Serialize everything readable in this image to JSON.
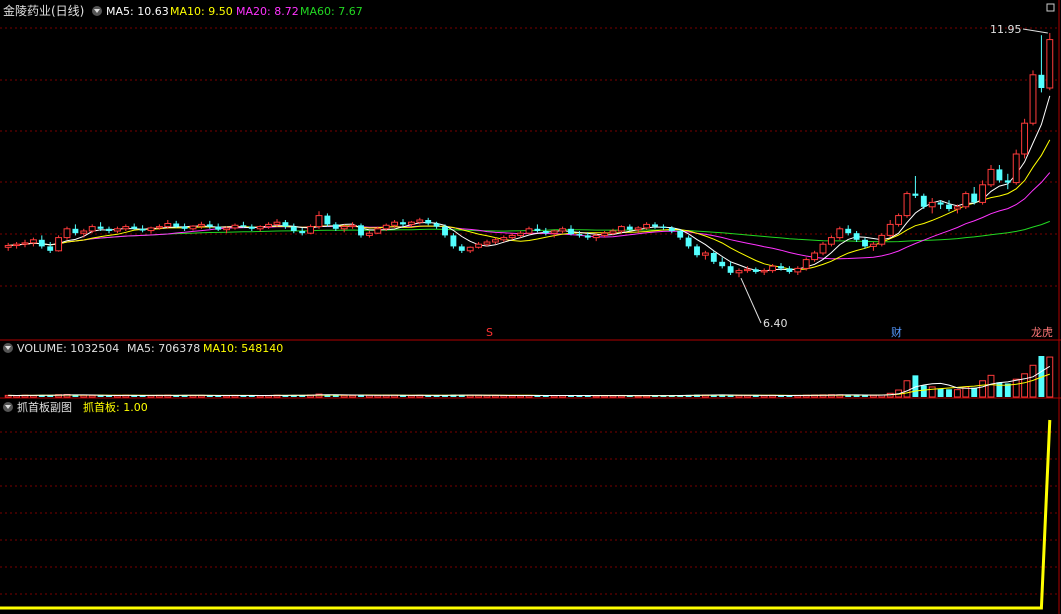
{
  "colors": {
    "background": "#000000",
    "grid": "#7a0000",
    "panel_border": "#b00000",
    "up": "#ff3b3b",
    "down": "#54ffff",
    "title_text": "#e0e0e0",
    "ma5": "#ffffff",
    "ma10": "#ffff00",
    "ma20": "#ff33ff",
    "ma60": "#22d822",
    "indicator": "#ffff00",
    "marker_s": "#ff3333",
    "marker_cai": "#5599ff",
    "marker_longhu": "#ff7777"
  },
  "header": {
    "stock_title": "金陵药业(日线)",
    "ma5": "MA5: 10.63",
    "ma10": "MA10: 9.50",
    "ma20": "MA20: 8.72",
    "ma60": "MA60: 7.67"
  },
  "annotations": {
    "high": "11.95",
    "low": "6.40",
    "marker_s": "S",
    "marker_cai": "财",
    "marker_longhu": "龙虎"
  },
  "volume_header": {
    "volume": "VOLUME: 1032504",
    "ma5": "MA5: 706378",
    "ma10": "MA10: 548140"
  },
  "indicator_header": {
    "name": "抓首板副图",
    "value": "抓首板: 1.00"
  },
  "chart_data": {
    "type": "candlestick",
    "title": "金陵药业(日线)",
    "price_range": [
      5.2,
      12.2
    ],
    "annotated_high": 11.95,
    "annotated_low": 6.4,
    "grid": true,
    "candles": [
      [
        7.08,
        7.18,
        7.0,
        7.12
      ],
      [
        7.12,
        7.2,
        7.05,
        7.15
      ],
      [
        7.15,
        7.25,
        7.08,
        7.18
      ],
      [
        7.18,
        7.3,
        7.1,
        7.25
      ],
      [
        7.25,
        7.35,
        7.05,
        7.1
      ],
      [
        7.1,
        7.2,
        6.95,
        7.0
      ],
      [
        7.0,
        7.35,
        6.98,
        7.3
      ],
      [
        7.3,
        7.55,
        7.25,
        7.5
      ],
      [
        7.5,
        7.6,
        7.35,
        7.4
      ],
      [
        7.4,
        7.5,
        7.3,
        7.45
      ],
      [
        7.45,
        7.6,
        7.4,
        7.55
      ],
      [
        7.55,
        7.65,
        7.45,
        7.5
      ],
      [
        7.5,
        7.55,
        7.4,
        7.45
      ],
      [
        7.45,
        7.55,
        7.4,
        7.5
      ],
      [
        7.5,
        7.6,
        7.45,
        7.55
      ],
      [
        7.55,
        7.62,
        7.48,
        7.5
      ],
      [
        7.5,
        7.58,
        7.42,
        7.46
      ],
      [
        7.46,
        7.55,
        7.4,
        7.52
      ],
      [
        7.52,
        7.6,
        7.48,
        7.55
      ],
      [
        7.55,
        7.7,
        7.5,
        7.62
      ],
      [
        7.62,
        7.68,
        7.52,
        7.55
      ],
      [
        7.55,
        7.62,
        7.45,
        7.5
      ],
      [
        7.5,
        7.58,
        7.46,
        7.56
      ],
      [
        7.56,
        7.66,
        7.5,
        7.6
      ],
      [
        7.6,
        7.68,
        7.5,
        7.55
      ],
      [
        7.55,
        7.62,
        7.45,
        7.48
      ],
      [
        7.48,
        7.55,
        7.4,
        7.52
      ],
      [
        7.52,
        7.62,
        7.48,
        7.58
      ],
      [
        7.58,
        7.66,
        7.52,
        7.55
      ],
      [
        7.55,
        7.6,
        7.45,
        7.5
      ],
      [
        7.5,
        7.58,
        7.44,
        7.55
      ],
      [
        7.55,
        7.65,
        7.5,
        7.6
      ],
      [
        7.6,
        7.72,
        7.55,
        7.65
      ],
      [
        7.65,
        7.7,
        7.5,
        7.55
      ],
      [
        7.55,
        7.62,
        7.4,
        7.45
      ],
      [
        7.45,
        7.52,
        7.35,
        7.4
      ],
      [
        7.4,
        7.6,
        7.38,
        7.55
      ],
      [
        7.55,
        7.9,
        7.5,
        7.8
      ],
      [
        7.8,
        7.85,
        7.55,
        7.6
      ],
      [
        7.6,
        7.65,
        7.45,
        7.5
      ],
      [
        7.5,
        7.6,
        7.42,
        7.55
      ],
      [
        7.55,
        7.65,
        7.5,
        7.58
      ],
      [
        7.58,
        7.62,
        7.3,
        7.35
      ],
      [
        7.35,
        7.45,
        7.3,
        7.4
      ],
      [
        7.4,
        7.55,
        7.38,
        7.5
      ],
      [
        7.5,
        7.62,
        7.45,
        7.58
      ],
      [
        7.58,
        7.7,
        7.52,
        7.65
      ],
      [
        7.65,
        7.72,
        7.55,
        7.6
      ],
      [
        7.6,
        7.68,
        7.55,
        7.65
      ],
      [
        7.65,
        7.75,
        7.6,
        7.7
      ],
      [
        7.7,
        7.75,
        7.58,
        7.62
      ],
      [
        7.62,
        7.66,
        7.5,
        7.55
      ],
      [
        7.55,
        7.6,
        7.3,
        7.35
      ],
      [
        7.35,
        7.4,
        7.05,
        7.1
      ],
      [
        7.1,
        7.15,
        6.95,
        7.0
      ],
      [
        7.0,
        7.1,
        6.95,
        7.08
      ],
      [
        7.08,
        7.2,
        7.05,
        7.15
      ],
      [
        7.15,
        7.25,
        7.1,
        7.2
      ],
      [
        7.2,
        7.3,
        7.15,
        7.25
      ],
      [
        7.25,
        7.35,
        7.2,
        7.3
      ],
      [
        7.3,
        7.4,
        7.25,
        7.35
      ],
      [
        7.35,
        7.45,
        7.3,
        7.4
      ],
      [
        7.4,
        7.55,
        7.38,
        7.5
      ],
      [
        7.5,
        7.6,
        7.42,
        7.45
      ],
      [
        7.45,
        7.52,
        7.35,
        7.4
      ],
      [
        7.4,
        7.48,
        7.3,
        7.45
      ],
      [
        7.45,
        7.55,
        7.4,
        7.5
      ],
      [
        7.5,
        7.58,
        7.35,
        7.38
      ],
      [
        7.38,
        7.45,
        7.3,
        7.35
      ],
      [
        7.35,
        7.42,
        7.25,
        7.3
      ],
      [
        7.3,
        7.4,
        7.22,
        7.35
      ],
      [
        7.35,
        7.45,
        7.3,
        7.4
      ],
      [
        7.4,
        7.5,
        7.35,
        7.45
      ],
      [
        7.45,
        7.58,
        7.4,
        7.55
      ],
      [
        7.55,
        7.6,
        7.45,
        7.48
      ],
      [
        7.48,
        7.56,
        7.4,
        7.52
      ],
      [
        7.52,
        7.65,
        7.48,
        7.6
      ],
      [
        7.6,
        7.65,
        7.5,
        7.55
      ],
      [
        7.55,
        7.6,
        7.48,
        7.52
      ],
      [
        7.52,
        7.56,
        7.4,
        7.45
      ],
      [
        7.45,
        7.48,
        7.25,
        7.3
      ],
      [
        7.3,
        7.35,
        7.05,
        7.1
      ],
      [
        7.1,
        7.15,
        6.85,
        6.9
      ],
      [
        6.9,
        7.0,
        6.8,
        6.95
      ],
      [
        6.95,
        7.0,
        6.7,
        6.75
      ],
      [
        6.75,
        6.85,
        6.6,
        6.65
      ],
      [
        6.65,
        6.75,
        6.45,
        6.5
      ],
      [
        6.5,
        6.6,
        6.4,
        6.55
      ],
      [
        6.55,
        6.65,
        6.5,
        6.58
      ],
      [
        6.58,
        6.62,
        6.48,
        6.52
      ],
      [
        6.52,
        6.6,
        6.45,
        6.55
      ],
      [
        6.55,
        6.7,
        6.5,
        6.65
      ],
      [
        6.65,
        6.72,
        6.55,
        6.6
      ],
      [
        6.6,
        6.65,
        6.48,
        6.52
      ],
      [
        6.52,
        6.65,
        6.45,
        6.6
      ],
      [
        6.6,
        6.85,
        6.55,
        6.8
      ],
      [
        6.8,
        7.0,
        6.75,
        6.95
      ],
      [
        6.95,
        7.2,
        6.9,
        7.15
      ],
      [
        7.15,
        7.35,
        7.1,
        7.3
      ],
      [
        7.3,
        7.55,
        7.25,
        7.5
      ],
      [
        7.5,
        7.58,
        7.35,
        7.4
      ],
      [
        7.4,
        7.45,
        7.2,
        7.25
      ],
      [
        7.25,
        7.3,
        7.05,
        7.1
      ],
      [
        7.1,
        7.2,
        7.0,
        7.15
      ],
      [
        7.15,
        7.4,
        7.1,
        7.35
      ],
      [
        7.35,
        7.7,
        7.3,
        7.6
      ],
      [
        7.6,
        7.85,
        7.55,
        7.8
      ],
      [
        7.8,
        8.35,
        7.75,
        8.3
      ],
      [
        8.3,
        8.7,
        8.2,
        8.25
      ],
      [
        8.25,
        8.3,
        7.95,
        8.0
      ],
      [
        8.0,
        8.2,
        7.85,
        8.1
      ],
      [
        8.1,
        8.15,
        7.95,
        8.05
      ],
      [
        8.05,
        8.15,
        7.9,
        7.95
      ],
      [
        7.95,
        8.05,
        7.85,
        8.0
      ],
      [
        8.0,
        8.35,
        7.95,
        8.3
      ],
      [
        8.3,
        8.45,
        8.05,
        8.1
      ],
      [
        8.1,
        8.6,
        8.05,
        8.5
      ],
      [
        8.5,
        8.95,
        8.45,
        8.85
      ],
      [
        8.85,
        8.95,
        8.55,
        8.6
      ],
      [
        8.6,
        8.75,
        8.4,
        8.55
      ],
      [
        8.55,
        9.3,
        8.5,
        9.2
      ],
      [
        9.2,
        10.0,
        9.1,
        9.9
      ],
      [
        9.9,
        11.1,
        9.85,
        11.0
      ],
      [
        11.0,
        11.9,
        10.6,
        10.7
      ],
      [
        10.7,
        11.95,
        10.65,
        11.8
      ]
    ],
    "ma5_last": 10.63,
    "ma10_last": 9.5,
    "ma20_last": 8.72,
    "ma60_last": 7.67,
    "volume": {
      "last": 1032504,
      "ma5": 706378,
      "ma10": 548140,
      "max": 1060000,
      "values": [
        42000,
        38000,
        45000,
        40000,
        52000,
        48000,
        60000,
        65000,
        50000,
        44000,
        40000,
        38000,
        36000,
        42000,
        45000,
        40000,
        37000,
        39000,
        43000,
        48000,
        44000,
        41000,
        39000,
        42000,
        40000,
        38000,
        36000,
        41000,
        43000,
        39000,
        37000,
        40000,
        46000,
        44000,
        50000,
        47000,
        52000,
        75000,
        58000,
        46000,
        42000,
        40000,
        55000,
        44000,
        41000,
        43000,
        46000,
        42000,
        40000,
        44000,
        41000,
        39000,
        48000,
        60000,
        52000,
        45000,
        42000,
        40000,
        38000,
        39000,
        37000,
        36000,
        40000,
        42000,
        39000,
        37000,
        38000,
        40000,
        37000,
        36000,
        35000,
        37000,
        38000,
        40000,
        36000,
        35000,
        38000,
        37000,
        36000,
        35000,
        42000,
        55000,
        62000,
        50000,
        52000,
        48000,
        45000,
        44000,
        40000,
        38000,
        39000,
        42000,
        40000,
        38000,
        41000,
        46000,
        50000,
        55000,
        60000,
        58000,
        52000,
        48000,
        45000,
        44000,
        52000,
        95000,
        180000,
        420000,
        560000,
        300000,
        260000,
        220000,
        200000,
        190000,
        260000,
        240000,
        420000,
        560000,
        380000,
        350000,
        460000,
        600000,
        820000,
        1060000,
        1032504
      ]
    },
    "indicator": {
      "name": "抓首板",
      "last": 1.0,
      "range": [
        0,
        1
      ],
      "values_last_bars": [
        0,
        1
      ]
    }
  }
}
